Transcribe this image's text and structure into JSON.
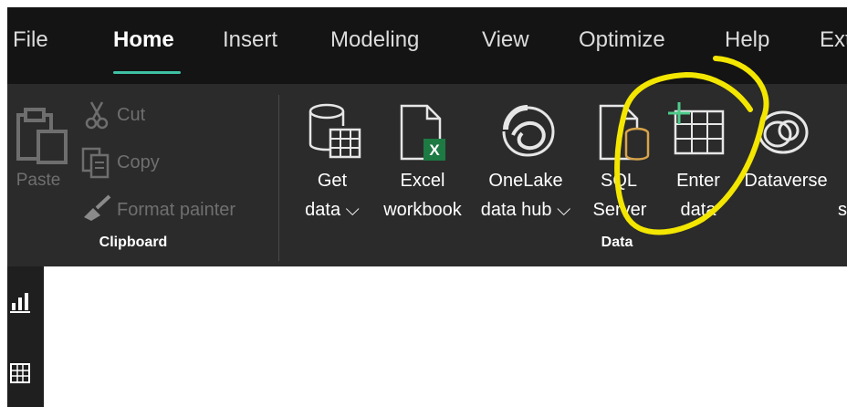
{
  "menu": {
    "tabs": [
      {
        "label": "File"
      },
      {
        "label": "Home"
      },
      {
        "label": "Insert"
      },
      {
        "label": "Modeling"
      },
      {
        "label": "View"
      },
      {
        "label": "Optimize"
      },
      {
        "label": "Help"
      },
      {
        "label": "Ext"
      }
    ],
    "active_tab": "Home"
  },
  "ribbon": {
    "clipboard": {
      "group_label": "Clipboard",
      "paste": "Paste",
      "cut": "Cut",
      "copy": "Copy",
      "format_painter": "Format painter"
    },
    "data": {
      "group_label": "Data",
      "get_data": {
        "line1": "Get",
        "line2": "data ⌵"
      },
      "excel": {
        "line1": "Excel",
        "line2": "workbook"
      },
      "onelake": {
        "line1": "OneLake",
        "line2": "data hub ⌵"
      },
      "sql": {
        "line1": "SQL",
        "line2": "Server"
      },
      "enter_data": {
        "line1": "Enter",
        "line2": "data"
      },
      "dataverse": {
        "line1": "Dataverse"
      },
      "partial": {
        "line2": "s"
      }
    }
  },
  "colors": {
    "accent": "#3fc1a5",
    "highlight_circle": "#f3e600",
    "excel_green": "#1d7a43",
    "sql_orange": "#d8a44b"
  }
}
